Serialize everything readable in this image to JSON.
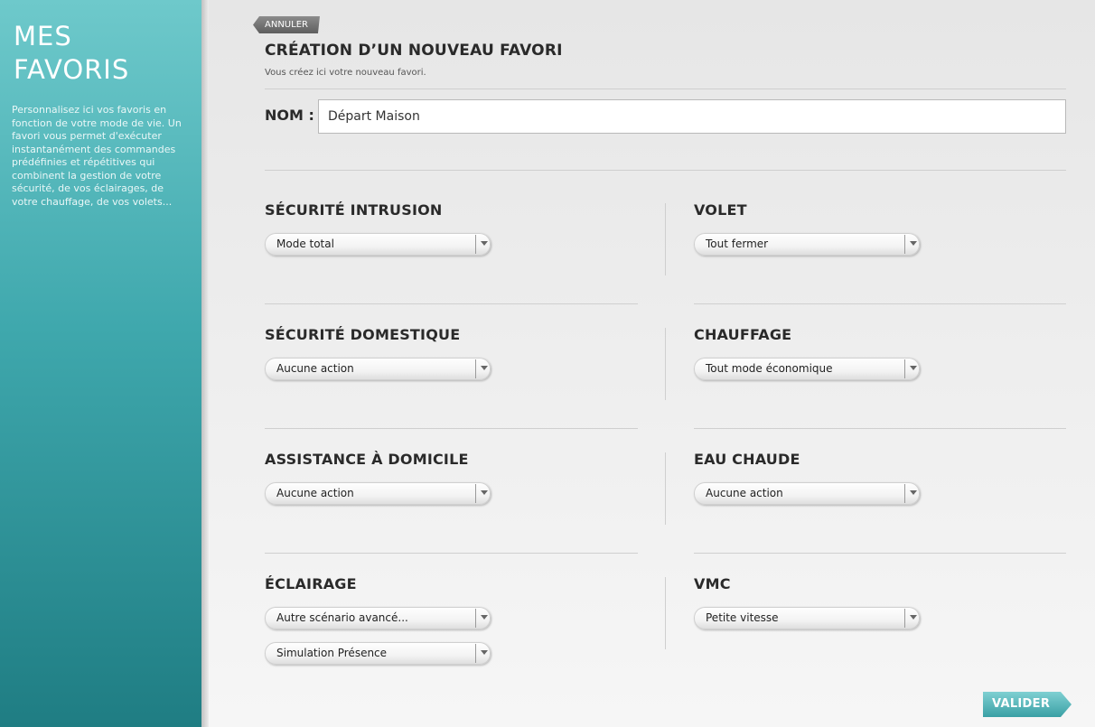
{
  "sidebar": {
    "title_line1": "MES",
    "title_line2": "FAVORIS",
    "description": "Personnalisez ici vos favoris en fonction de votre mode de vie. Un favori vous permet d'exécuter instantanément des commandes prédéfinies et répétitives qui combinent la gestion de votre sécurité, de vos éclairages, de votre chauffage, de vos volets..."
  },
  "header": {
    "cancel_label": "ANNULER",
    "title": "CRÉATION D’UN NOUVEAU FAVORI",
    "subtitle": "Vous créez ici votre nouveau favori."
  },
  "name_field": {
    "label": "NOM :",
    "value": "Départ Maison"
  },
  "sections": {
    "securite_intrusion": {
      "title": "SÉCURITÉ INTRUSION",
      "selected": "Mode total"
    },
    "volet": {
      "title": "VOLET",
      "selected": "Tout fermer"
    },
    "securite_domestique": {
      "title": "SÉCURITÉ DOMESTIQUE",
      "selected": "Aucune action"
    },
    "chauffage": {
      "title": "CHAUFFAGE",
      "selected": "Tout mode économique"
    },
    "assistance": {
      "title": "ASSISTANCE À DOMICILE",
      "selected": "Aucune action"
    },
    "eau_chaude": {
      "title": "EAU CHAUDE",
      "selected": "Aucune action"
    },
    "eclairage": {
      "title": "ÉCLAIRAGE",
      "selected": "Autre scénario avancé...",
      "selected_2": "Simulation Présence"
    },
    "vmc": {
      "title": "VMC",
      "selected": "Petite vitesse"
    }
  },
  "footer": {
    "validate_label": "VALIDER"
  },
  "colors": {
    "accent": "#3fa8ad",
    "sidebar_top": "#6ec9cb",
    "sidebar_bottom": "#1f7d83",
    "cancel_button": "#6e6e6e"
  }
}
